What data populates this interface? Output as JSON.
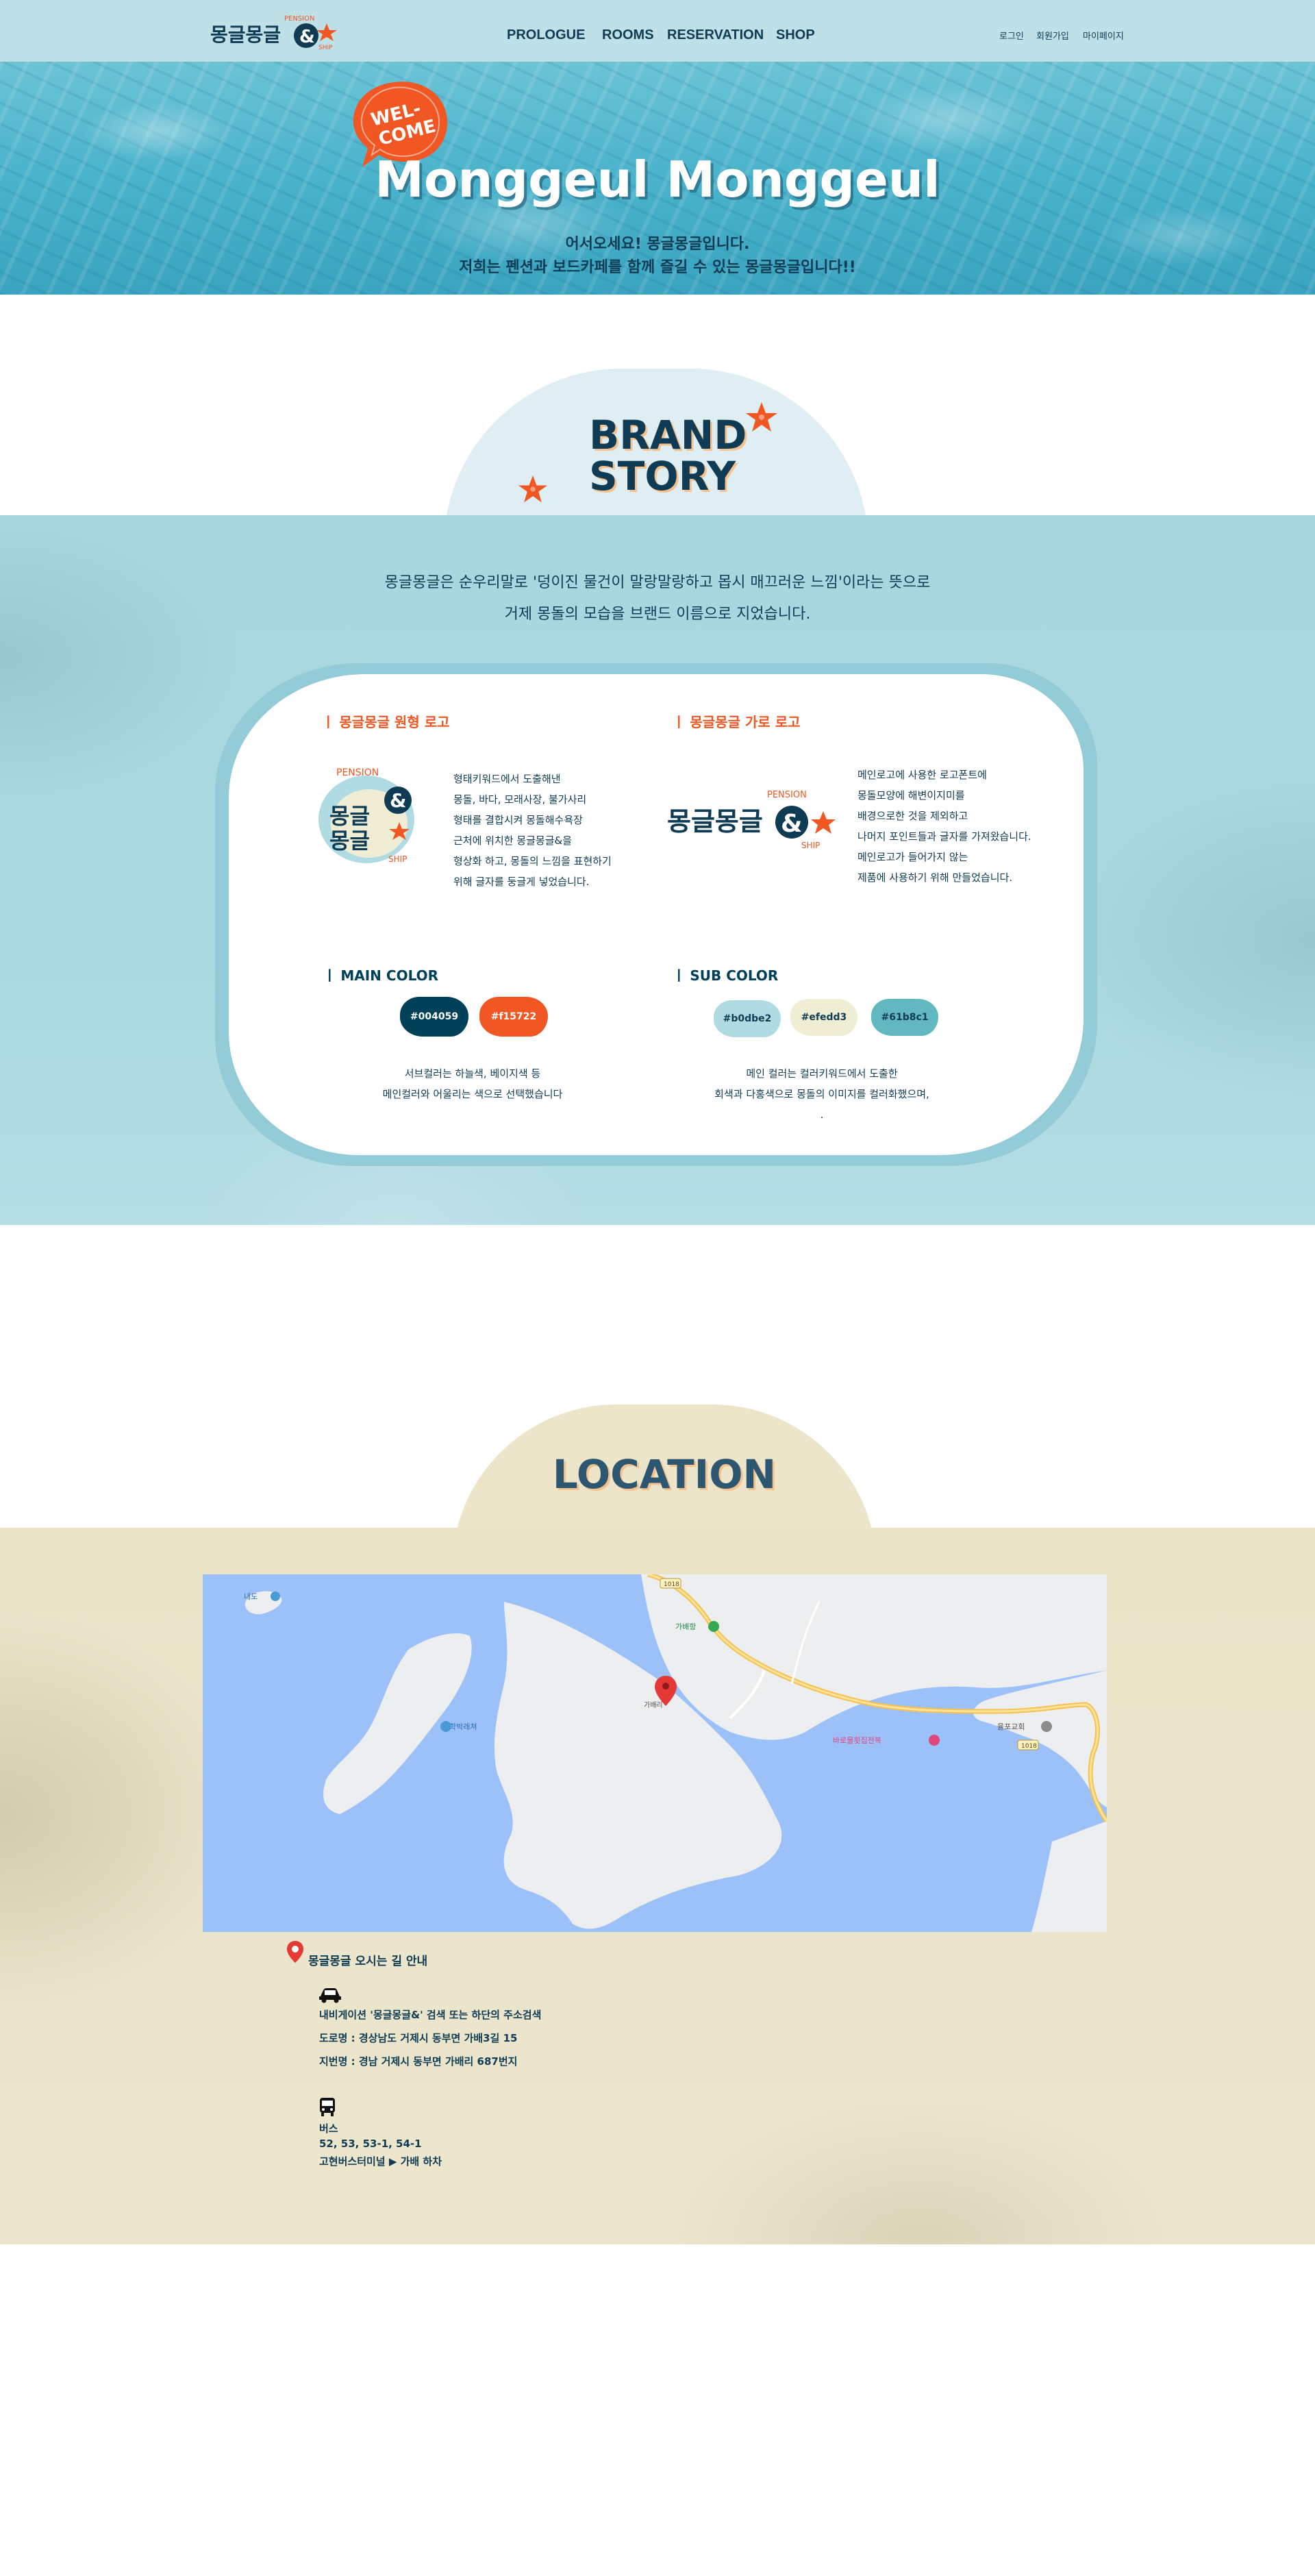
{
  "header": {
    "logo_text": "몽글몽글&",
    "logo_tag": "PENSION SHIP",
    "nav": [
      "PROLOGUE",
      "ROOMS",
      "RESERVATION",
      "SHOP"
    ],
    "util": [
      "로그인",
      "회원가입",
      "마이페이지"
    ]
  },
  "hero": {
    "badge": "WEL-COME",
    "title": "Monggeul Monggeul",
    "line1": "어서오세요! 몽글몽글입니다.",
    "line2": "저희는 펜션과 보드카페를 함께 즐길 수 있는 몽글몽글입니다!!"
  },
  "brand": {
    "title_line1": "BRAND",
    "title_line2": "STORY",
    "intro_line1": "몽글몽글은 순우리말로 '덩이진 물건이 말랑말랑하고 몹시 매끄러운 느낌'이라는 뜻으로",
    "intro_line2": "거제 몽돌의 모습을 브랜드 이름으로 지었습니다.",
    "round_logo": {
      "heading": "ㅣ 몽글몽글 원형 로고",
      "lines": [
        "형태키워드에서 도출해낸",
        "몽돌, 바다, 모래사장, 불가사리",
        "형태를 결합시켜 몽돌해수욕장",
        "근처에 위치한 몽글몽글&을",
        "형상화 하고, 몽돌의 느낌을 표현하기",
        "위해 글자를 둥글게 넣었습니다."
      ]
    },
    "wide_logo": {
      "heading": "ㅣ 몽글몽글 가로 로고",
      "lines": [
        "메인로고에 사용한 로고폰트에",
        "몽돌모양에 해변이지미를",
        "배경으로한 것을 제외하고",
        "나머지 포인트들과 글자를 가져왔습니다.",
        "메인로고가 들어가지 않는",
        "제품에 사용하기 위해 만들었습니다."
      ]
    },
    "main_color": {
      "heading": "ㅣ MAIN COLOR",
      "swatches": [
        {
          "label": "#004059",
          "color": "#004059",
          "text": "#ffffff"
        },
        {
          "label": "#f15722",
          "color": "#f15722",
          "text": "#ffffff"
        }
      ],
      "line1": "서브컬러는 하늘색, 베이지색 등",
      "line2": "메인컬러와 어울리는 색으로 선택했습니다"
    },
    "sub_color": {
      "heading": "ㅣ SUB COLOR",
      "swatches": [
        {
          "label": "#b0dbe2",
          "color": "#b0dbe2",
          "text": "#0f3b54"
        },
        {
          "label": "#efedd3",
          "color": "#efedd3",
          "text": "#0f3b54"
        },
        {
          "label": "#61b8c1",
          "color": "#61b8c1",
          "text": "#0f3b54"
        }
      ],
      "line1": "메인 컬러는 컬러키워드에서 도출한",
      "line2": "회색과 다홍색으로 몽돌의 이미지를 컬러화했으며,",
      "line3": "."
    }
  },
  "location": {
    "title": "LOCATION",
    "map_labels": {
      "island": "내도",
      "mongdol": "가배항",
      "harbor": "학박래쳐",
      "pension": "가배리",
      "restaurant": "바로물횟집전복",
      "church": "율포교회",
      "route1": "1018",
      "route2": "1018"
    },
    "directions_title": "몽글몽글 오시는 길 안내",
    "car_line1": "내비게이션 '몽글몽글&' 검색 또는 하단의 주소검색",
    "car_line2": "도로명 : 경상남도 거제시 동부면 가배3길 15",
    "car_line3": "지번명 : 경남 거제시 동부면 가배리 687번지",
    "bus_label": "버스",
    "bus_routes": "52, 53, 53-1, 54-1",
    "bus_stop": "고현버스터미널 ▶ 가배 하차"
  },
  "colors": {
    "navy": "#004059",
    "orange": "#f15722",
    "sky": "#b0dbe2",
    "beige": "#efedd3",
    "teal": "#61b8c1"
  }
}
